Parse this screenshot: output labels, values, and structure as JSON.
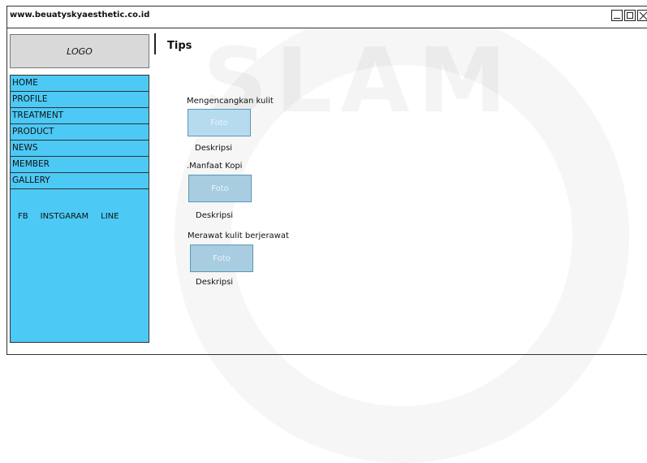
{
  "window": {
    "url": "www.beuatyskyaesthetic.co.id"
  },
  "watermark": {
    "text": "SLAM"
  },
  "logo": {
    "label": "LOGO"
  },
  "sidebar": {
    "items": [
      {
        "label": "HOME"
      },
      {
        "label": "PROFILE"
      },
      {
        "label": "TREATMENT"
      },
      {
        "label": "PRODUCT"
      },
      {
        "label": "NEWS"
      },
      {
        "label": "MEMBER"
      },
      {
        "label": "GALLERY"
      }
    ],
    "social": [
      "FB",
      "INSTGARAM",
      "LINE"
    ]
  },
  "main": {
    "title": "Tips",
    "tips": [
      {
        "title": "Mengencangkan kulit",
        "photo": "Foto",
        "description": "Deskripsi"
      },
      {
        "title": ".Manfaat Kopi",
        "photo": "Foto",
        "description": "Deskripsi"
      },
      {
        "title": "Merawat kulit berjerawat",
        "photo": "Foto",
        "description": "Deskripsi"
      }
    ]
  },
  "colors": {
    "sidebar": "#4cc9f5",
    "photo_placeholder": "#a8cde0",
    "logo_box": "#d9d9d9"
  }
}
